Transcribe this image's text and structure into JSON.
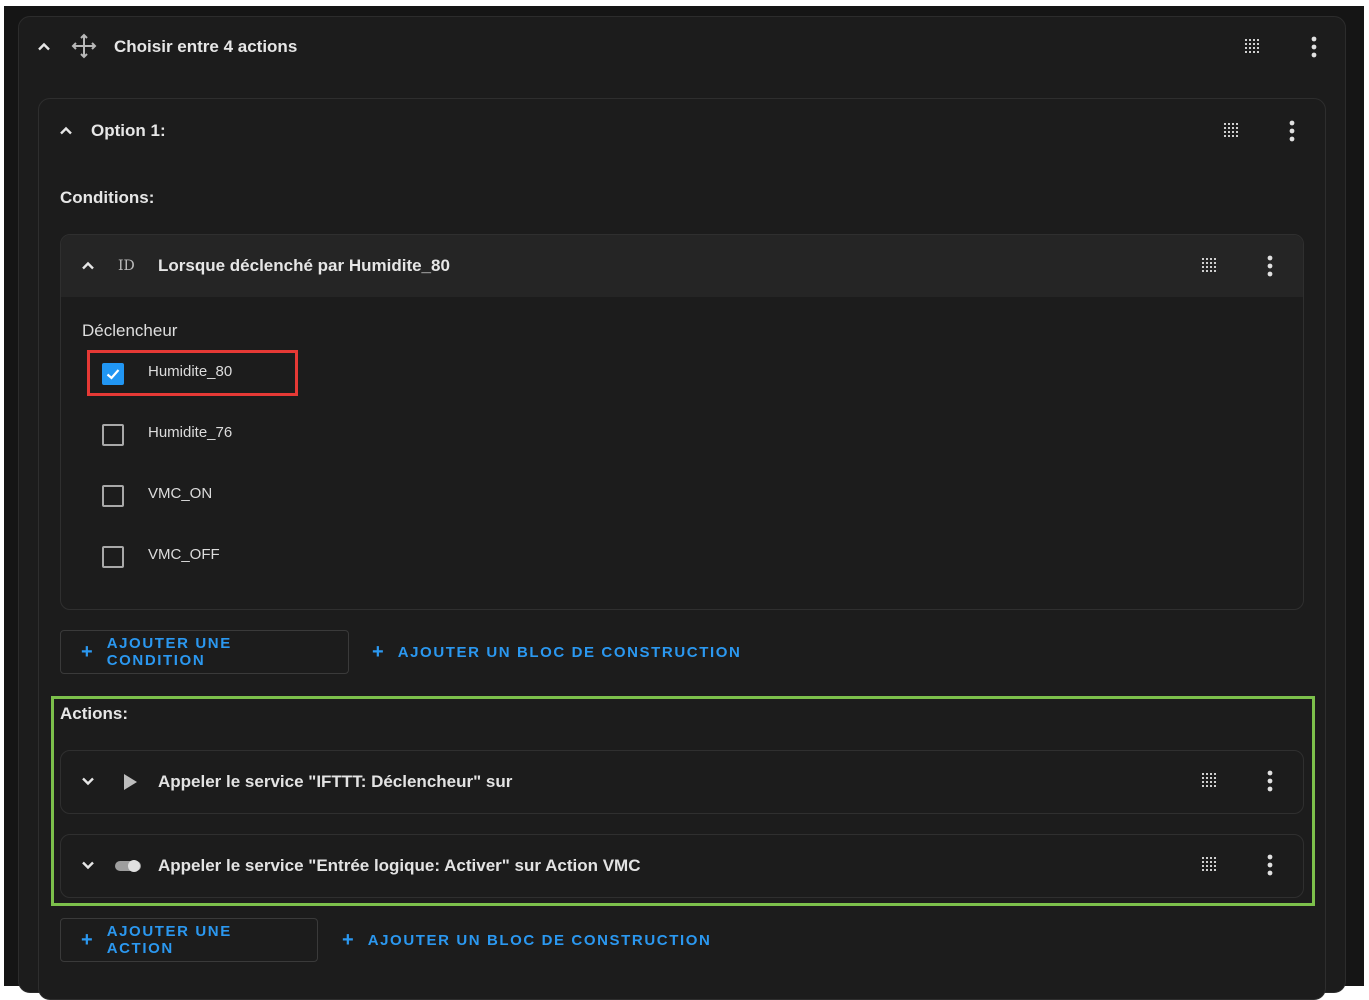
{
  "choose": {
    "title": "Choisir entre 4 actions"
  },
  "option": {
    "title": "Option 1:",
    "conditions_label": "Conditions:",
    "condition": {
      "id_badge": "ID",
      "title": "Lorsque déclenché par Humidite_80",
      "trigger_label": "Déclencheur",
      "triggers": [
        {
          "label": "Humidite_80",
          "checked": true
        },
        {
          "label": "Humidite_76",
          "checked": false
        },
        {
          "label": "VMC_ON",
          "checked": false
        },
        {
          "label": "VMC_OFF",
          "checked": false
        }
      ]
    },
    "add_condition": "AJOUTER UNE CONDITION",
    "add_block_1": "AJOUTER UN BLOC DE CONSTRUCTION",
    "actions_label": "Actions:",
    "actions": [
      {
        "title": "Appeler le service \"IFTTT: Déclencheur\" sur",
        "icon": "play-icon"
      },
      {
        "title": "Appeler le service \"Entrée logique: Activer\" sur Action VMC",
        "icon": "toggle-icon"
      }
    ],
    "add_action": "AJOUTER UNE ACTION",
    "add_block_2": "AJOUTER UN BLOC DE CONSTRUCTION"
  },
  "colors": {
    "accent": "#2b98f0",
    "highlight_red": "#e53935",
    "highlight_green": "#7cc04b",
    "background": "#1c1c1c"
  }
}
